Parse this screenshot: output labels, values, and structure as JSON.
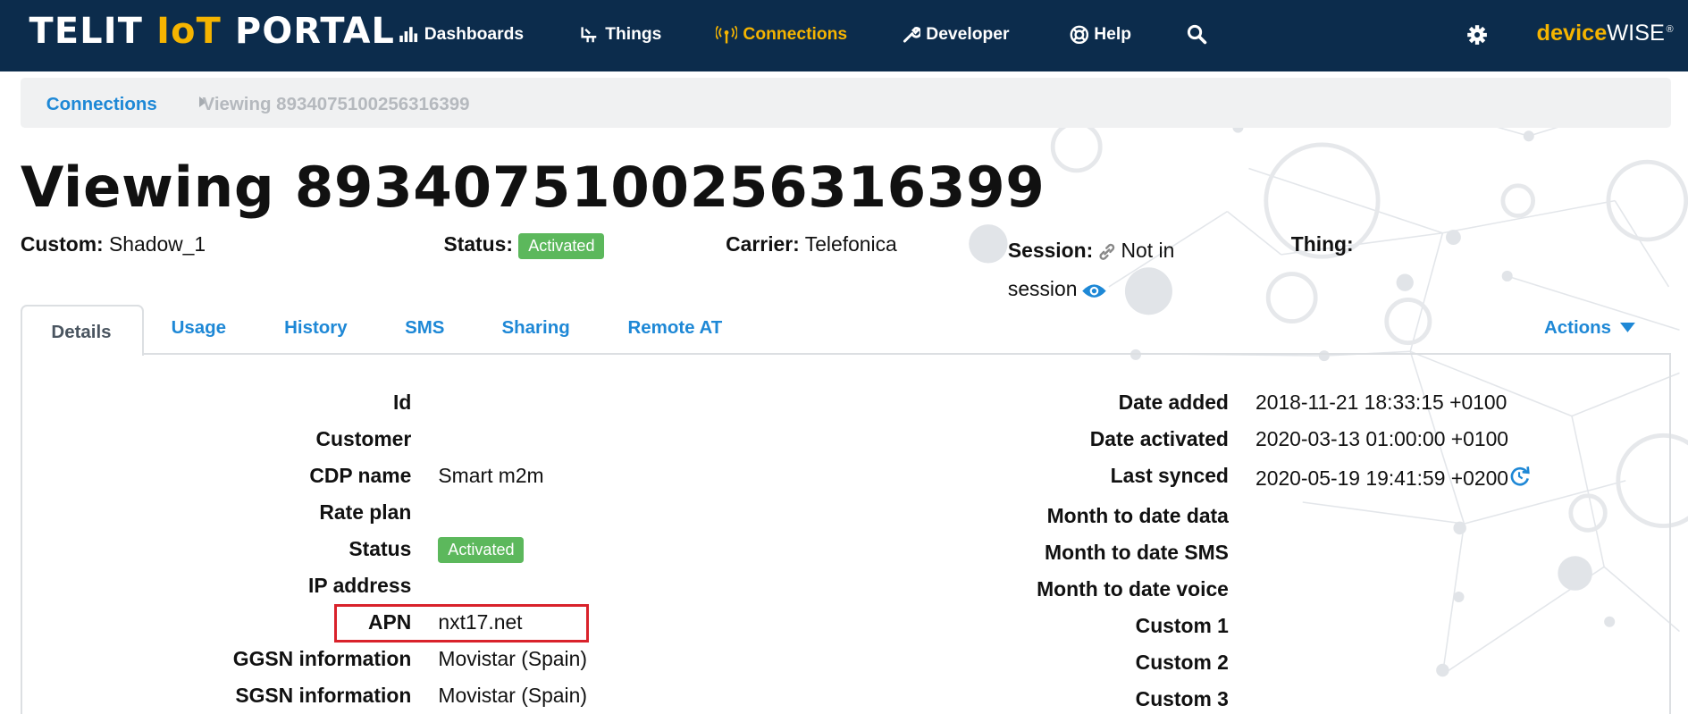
{
  "header": {
    "logo": {
      "part1": "TELIT",
      "part2": "IoT",
      "part3": "PORTAL"
    },
    "nav": [
      {
        "label": "Dashboards",
        "icon": "bar-chart-icon",
        "active": false
      },
      {
        "label": "Things",
        "icon": "things-icon",
        "active": false
      },
      {
        "label": "Connections",
        "icon": "antenna-icon",
        "active": true
      },
      {
        "label": "Developer",
        "icon": "wrench-icon",
        "active": false
      },
      {
        "label": "Help",
        "icon": "lifebuoy-icon",
        "active": false
      }
    ],
    "search_icon": "search-icon",
    "settings_icon": "gear-icon",
    "brand": {
      "part1": "device",
      "part2": "WISE",
      "mark": "®"
    }
  },
  "breadcrumb": {
    "link": "Connections",
    "current": "Viewing 89340751002563163​99"
  },
  "page": {
    "title": "Viewing 8934075100256316399",
    "custom_label": "Custom:",
    "custom_value": "Shadow_1",
    "status_label": "Status:",
    "status_value": "Activated",
    "carrier_label": "Carrier:",
    "carrier_value": "Telefonica",
    "session_label": "Session:",
    "session_value_1": "Not in",
    "session_value_2": "session",
    "thing_label": "Thing:"
  },
  "tabs": [
    "Details",
    "Usage",
    "History",
    "SMS",
    "Sharing",
    "Remote AT"
  ],
  "actions_label": "Actions",
  "details_left": [
    {
      "label": "Id",
      "value": ""
    },
    {
      "label": "Customer",
      "value": ""
    },
    {
      "label": "CDP name",
      "value": "Smart m2m"
    },
    {
      "label": "Rate plan",
      "value": ""
    },
    {
      "label": "Status",
      "value": "Activated"
    },
    {
      "label": "IP address",
      "value": ""
    },
    {
      "label": "APN",
      "value": "nxt17.net"
    },
    {
      "label": "GGSN information",
      "value": "Movistar (Spain)"
    },
    {
      "label": "SGSN information",
      "value": "Movistar (Spain)"
    }
  ],
  "details_right": [
    {
      "label": "Date added",
      "value": "2018-11-21 18:33:15 +0100"
    },
    {
      "label": "Date activated",
      "value": "2020-03-13 01:00:00 +0100"
    },
    {
      "label": "Last synced",
      "value": "2020-05-19 19:41:59 +0200"
    },
    {
      "label": "Month to date data",
      "value": ""
    },
    {
      "label": "Month to date SMS",
      "value": ""
    },
    {
      "label": "Month to date voice",
      "value": ""
    },
    {
      "label": "Custom 1",
      "value": ""
    },
    {
      "label": "Custom 2",
      "value": ""
    },
    {
      "label": "Custom 3",
      "value": ""
    }
  ],
  "colors": {
    "nav_bg": "#0c2c4c",
    "nav_active": "#f5b400",
    "link": "#1e88d6",
    "badge_green": "#5cb85c",
    "highlight_red": "#d9222b"
  }
}
